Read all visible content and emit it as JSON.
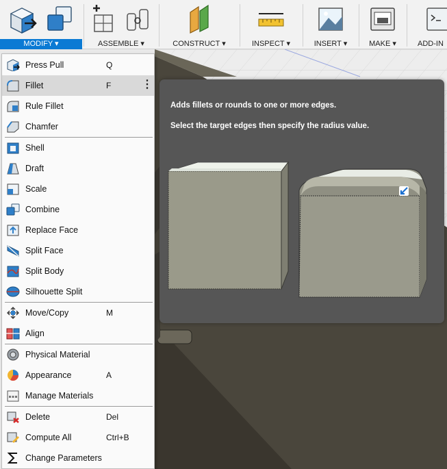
{
  "toolbar": {
    "groups": [
      {
        "label": "MODIFY ▾",
        "active": true
      },
      {
        "label": "ASSEMBLE ▾"
      },
      {
        "label": "CONSTRUCT ▾"
      },
      {
        "label": "INSPECT ▾"
      },
      {
        "label": "INSERT ▾"
      },
      {
        "label": "MAKE ▾"
      },
      {
        "label": "ADD-IN"
      }
    ]
  },
  "menu": {
    "items": [
      {
        "label": "Press Pull",
        "shortcut": "Q",
        "icon": "press-pull-icon"
      },
      {
        "label": "Fillet",
        "shortcut": "F",
        "icon": "fillet-icon",
        "highlighted": true,
        "more": "⋮"
      },
      {
        "label": "Rule Fillet",
        "shortcut": "",
        "icon": "rule-fillet-icon"
      },
      {
        "label": "Chamfer",
        "shortcut": "",
        "icon": "chamfer-icon"
      },
      {
        "label": "Shell",
        "shortcut": "",
        "icon": "shell-icon"
      },
      {
        "label": "Draft",
        "shortcut": "",
        "icon": "draft-icon"
      },
      {
        "label": "Scale",
        "shortcut": "",
        "icon": "scale-icon"
      },
      {
        "label": "Combine",
        "shortcut": "",
        "icon": "combine-icon"
      },
      {
        "label": "Replace Face",
        "shortcut": "",
        "icon": "replace-face-icon"
      },
      {
        "label": "Split Face",
        "shortcut": "",
        "icon": "split-face-icon"
      },
      {
        "label": "Split Body",
        "shortcut": "",
        "icon": "split-body-icon"
      },
      {
        "label": "Silhouette Split",
        "shortcut": "",
        "icon": "silhouette-split-icon"
      },
      {
        "label": "Move/Copy",
        "shortcut": "M",
        "icon": "move-copy-icon"
      },
      {
        "label": "Align",
        "shortcut": "",
        "icon": "align-icon"
      },
      {
        "label": "Physical Material",
        "shortcut": "",
        "icon": "physical-material-icon"
      },
      {
        "label": "Appearance",
        "shortcut": "A",
        "icon": "appearance-icon"
      },
      {
        "label": "Manage Materials",
        "shortcut": "",
        "icon": "manage-materials-icon"
      },
      {
        "label": "Delete",
        "shortcut": "Del",
        "icon": "delete-icon"
      },
      {
        "label": "Compute All",
        "shortcut": "Ctrl+B",
        "icon": "compute-all-icon"
      },
      {
        "label": "Change Parameters",
        "shortcut": "",
        "icon": "change-parameters-icon"
      }
    ]
  },
  "tooltip": {
    "line1": "Adds fillets or rounds to one or more edges.",
    "line2": "Select the target edges then specify the radius value."
  },
  "colors": {
    "accent": "#0a7ad4",
    "tooltip_bg": "#565656",
    "menu_highlight": "#d9d9d9"
  }
}
